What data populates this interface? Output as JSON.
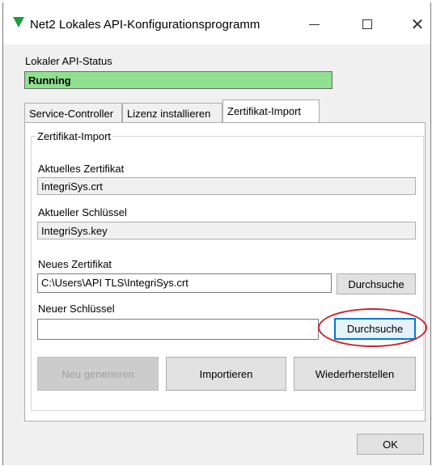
{
  "window": {
    "title": "Net2 Lokales API-Konfigurationsprogramm"
  },
  "status": {
    "label": "Lokaler API-Status",
    "value": "Running",
    "color": "#8fe08f"
  },
  "tabs": [
    {
      "label": "Service-Controller"
    },
    {
      "label": "Lizenz installieren"
    },
    {
      "label": "Zertifikat-Import",
      "active": true
    }
  ],
  "import": {
    "group_title": "Zertifikat-Import",
    "current_cert_label": "Aktuelles Zertifikat",
    "current_cert_value": "IntegriSys.crt",
    "current_key_label": "Aktueller Schlüssel",
    "current_key_value": "IntegriSys.key",
    "new_cert_label": "Neues Zertifikat",
    "new_cert_value": "C:\\Users\\API TLS\\IntegriSys.crt",
    "new_key_label": "Neuer Schlüssel",
    "new_key_value": "",
    "browse_label": "Durchsuche",
    "regenerate_label": "Neu generieren",
    "import_label": "Importieren",
    "restore_label": "Wiederherstellen"
  },
  "footer": {
    "ok_label": "OK"
  },
  "colors": {
    "highlight": "#cc2229",
    "focus": "#0078d7"
  }
}
